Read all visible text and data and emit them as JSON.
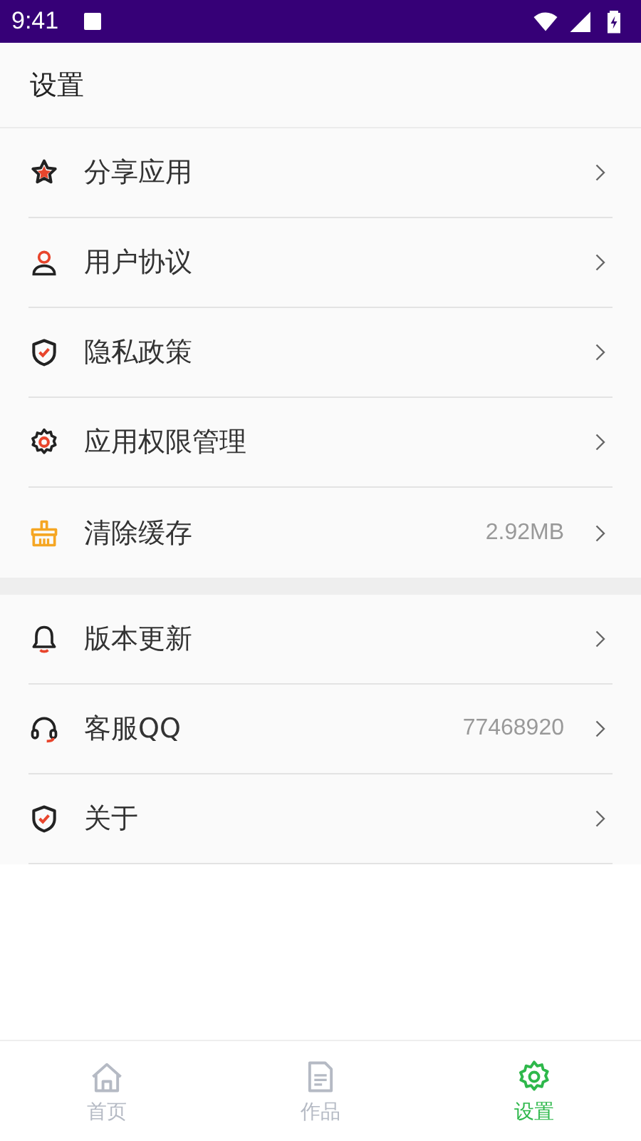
{
  "status_bar": {
    "time": "9:41"
  },
  "header": {
    "title": "设置"
  },
  "sections": [
    {
      "items": [
        {
          "label": "分享应用"
        },
        {
          "label": "用户协议"
        },
        {
          "label": "隐私政策"
        },
        {
          "label": "应用权限管理"
        },
        {
          "label": "清除缓存",
          "value": "2.92MB"
        }
      ]
    },
    {
      "items": [
        {
          "label": "版本更新"
        },
        {
          "label": "客服QQ",
          "value": "77468920"
        },
        {
          "label": "关于"
        }
      ]
    }
  ],
  "tabs": [
    {
      "label": "首页",
      "selected": false
    },
    {
      "label": "作品",
      "selected": false
    },
    {
      "label": "设置",
      "selected": true
    }
  ]
}
